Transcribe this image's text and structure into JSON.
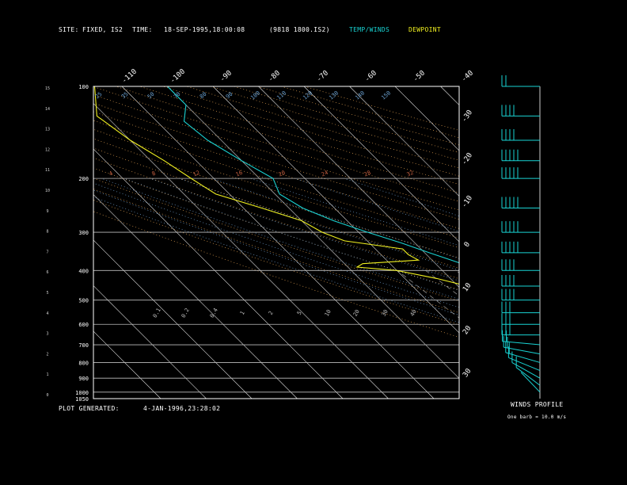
{
  "header": {
    "site_label": "SITE:",
    "site_value": "FIXED, IS2",
    "time_label": "TIME:",
    "time_value": "18-SEP-1995,18:00:08",
    "file_id": "(9818 1800.IS2)",
    "legend_temp": "TEMP/WINDS",
    "legend_dew": "DEWPOINT"
  },
  "footer": {
    "generated_label": "PLOT GENERATED:",
    "generated_value": "4-JAN-1996,23:28:02"
  },
  "winds_panel": {
    "title": "WINDS PROFILE",
    "note": "One barb = 10.0 m/s"
  },
  "colors": {
    "temp": "#19d3d3",
    "dewpoint": "#f0f020",
    "frame": "#ffffff",
    "isobar": "#bdbdbd",
    "dry_adiabat": "#e0a050",
    "moist_adiabat": "#70a0d0",
    "mixing_ratio": "#c06040",
    "dashed_dry": "#c09050"
  },
  "chart_data": {
    "type": "skew-t",
    "title": "",
    "xlabel": "",
    "ylabel": "",
    "pressure_levels": [
      100,
      200,
      300,
      400,
      500,
      600,
      700,
      800,
      900,
      1000,
      1050
    ],
    "pressure_labels": [
      "100",
      "200",
      "300",
      "400",
      "500",
      "600",
      "700",
      "800",
      "900",
      "1000",
      "1050"
    ],
    "height_km_labels": [
      "15",
      "14",
      "13",
      "12",
      "11",
      "10",
      "9",
      "8",
      "7",
      "6",
      "5",
      "4",
      "3",
      "2",
      "1",
      "0"
    ],
    "isotherm_labels_top": [
      "-110",
      "-100",
      "-90",
      "-80",
      "-70",
      "-60",
      "-50",
      "-40"
    ],
    "isotherm_labels_right": [
      "-30",
      "-20",
      "-10",
      "0",
      "10",
      "20",
      "30"
    ],
    "plim": [
      1050,
      100
    ],
    "series": [
      {
        "name": "TEMP",
        "points": [
          [
            1000,
            16
          ],
          [
            975,
            11
          ],
          [
            950,
            6
          ],
          [
            925,
            9
          ],
          [
            900,
            10
          ],
          [
            875,
            11
          ],
          [
            850,
            10
          ],
          [
            825,
            9
          ],
          [
            800,
            7
          ],
          [
            775,
            5
          ],
          [
            750,
            4
          ],
          [
            725,
            2
          ],
          [
            700,
            0
          ],
          [
            675,
            -2
          ],
          [
            650,
            -4
          ],
          [
            625,
            -6
          ],
          [
            600,
            -8
          ],
          [
            575,
            -11
          ],
          [
            550,
            -14
          ],
          [
            525,
            -17
          ],
          [
            500,
            -20
          ],
          [
            475,
            -22
          ],
          [
            450,
            -25
          ],
          [
            425,
            -28
          ],
          [
            400,
            -31
          ],
          [
            375,
            -35
          ],
          [
            350,
            -39
          ],
          [
            325,
            -43
          ],
          [
            300,
            -48
          ],
          [
            275,
            -53
          ],
          [
            250,
            -57
          ],
          [
            225,
            -59
          ],
          [
            200,
            -57
          ],
          [
            175,
            -60
          ],
          [
            150,
            -63
          ],
          [
            130,
            -64
          ],
          [
            115,
            -60
          ],
          [
            100,
            -60
          ]
        ]
      },
      {
        "name": "DEWPOINT",
        "points": [
          [
            1000,
            12
          ],
          [
            975,
            11
          ],
          [
            950,
            11
          ],
          [
            925,
            9
          ],
          [
            900,
            10
          ],
          [
            875,
            9
          ],
          [
            850,
            8
          ],
          [
            840,
            -30
          ],
          [
            825,
            -30
          ],
          [
            812,
            -42
          ],
          [
            806,
            -27
          ],
          [
            800,
            -5
          ],
          [
            790,
            -4
          ],
          [
            775,
            -4
          ],
          [
            750,
            -5
          ],
          [
            730,
            -4
          ],
          [
            720,
            -3
          ],
          [
            700,
            -8
          ],
          [
            680,
            -12
          ],
          [
            660,
            -10
          ],
          [
            640,
            -17
          ],
          [
            620,
            -17
          ],
          [
            610,
            -12
          ],
          [
            600,
            -12
          ],
          [
            590,
            -16
          ],
          [
            575,
            -14
          ],
          [
            550,
            -15
          ],
          [
            525,
            -18
          ],
          [
            500,
            -30
          ],
          [
            475,
            -35
          ],
          [
            450,
            -38
          ],
          [
            425,
            -43
          ],
          [
            400,
            -50
          ],
          [
            390,
            -58
          ],
          [
            380,
            -56
          ],
          [
            370,
            -43
          ],
          [
            355,
            -44
          ],
          [
            340,
            -44
          ],
          [
            320,
            -55
          ],
          [
            300,
            -58
          ],
          [
            275,
            -60
          ],
          [
            250,
            -66
          ],
          [
            225,
            -73
          ],
          [
            200,
            -75
          ],
          [
            175,
            -77
          ],
          [
            150,
            -80
          ],
          [
            125,
            -82
          ],
          [
            100,
            -76
          ]
        ]
      }
    ],
    "dry_adiabat_labels": [
      "25",
      "35",
      "50",
      "70",
      "80",
      "90",
      "100",
      "110",
      "120",
      "130",
      "140",
      "150",
      "160"
    ],
    "mixing_ratio_labels": [
      "0.1",
      "0.2",
      "0.4",
      "1",
      "2",
      "5",
      "10",
      "20",
      "30",
      "40"
    ],
    "wind_barbs": [
      {
        "p": 1000,
        "speed": 0
      },
      {
        "p": 950,
        "speed": 5
      },
      {
        "p": 900,
        "speed": 10
      },
      {
        "p": 850,
        "speed": 10
      },
      {
        "p": 800,
        "speed": 15
      },
      {
        "p": 750,
        "speed": 20
      },
      {
        "p": 700,
        "speed": 20
      },
      {
        "p": 650,
        "speed": 25
      },
      {
        "p": 600,
        "speed": 30
      },
      {
        "p": 550,
        "speed": 30
      },
      {
        "p": 500,
        "speed": 35
      },
      {
        "p": 450,
        "speed": 40
      },
      {
        "p": 400,
        "speed": 40
      },
      {
        "p": 350,
        "speed": 45
      },
      {
        "p": 300,
        "speed": 45
      },
      {
        "p": 250,
        "speed": 50
      },
      {
        "p": 200,
        "speed": 50
      },
      {
        "p": 175,
        "speed": 45
      },
      {
        "p": 150,
        "speed": 40
      },
      {
        "p": 125,
        "speed": 35
      },
      {
        "p": 100,
        "speed": 20
      }
    ]
  }
}
